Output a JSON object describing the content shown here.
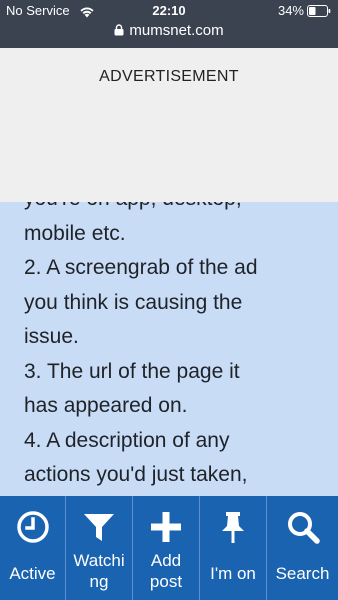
{
  "status": {
    "carrier": "No Service",
    "time": "22:10",
    "battery": "34%",
    "url": "mumsnet.com"
  },
  "ad": {
    "label": "ADVERTISEMENT"
  },
  "post": {
    "lines": [
      "you're on app, desktop,",
      "mobile etc.",
      "2. A screengrab of the ad",
      "you think is causing the",
      "issue.",
      "3. The url of the page it",
      "has appeared on.",
      "4. A description of any",
      "actions you'd just taken,"
    ]
  },
  "toolbar": {
    "active": {
      "label": "Active",
      "icon": "clock-icon"
    },
    "watching": {
      "label_1": "Watchi",
      "label_2": "ng",
      "icon": "filter-icon"
    },
    "add_post": {
      "label_1": "Add",
      "label_2": "post",
      "icon": "plus-icon"
    },
    "im_on": {
      "label": "I'm on",
      "icon": "pin-icon"
    },
    "search": {
      "label": "Search",
      "icon": "search-icon"
    }
  },
  "colors": {
    "status_bar": "#3b4350",
    "toolbar": "#1a63b0",
    "content_bg": "#c8dcf6",
    "ad_bg": "#efefef"
  }
}
